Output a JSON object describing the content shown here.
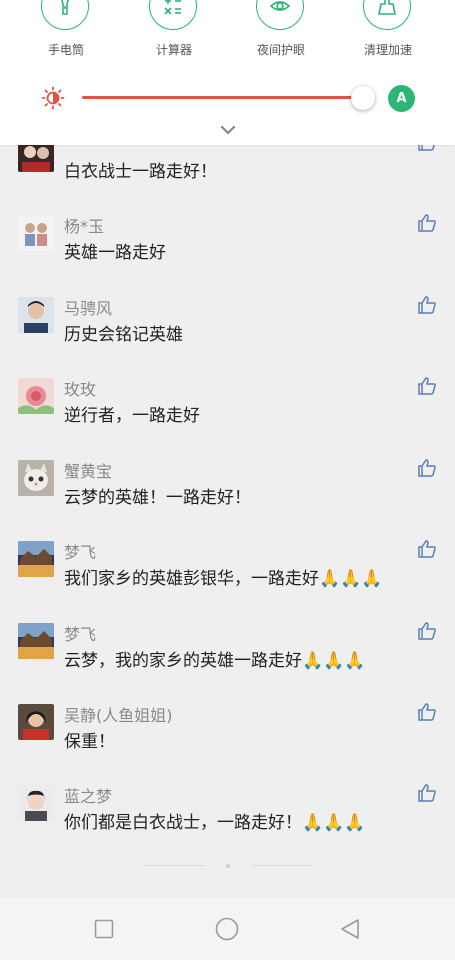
{
  "quick_tiles": [
    {
      "label": "手电筒",
      "icon": "flashlight-icon"
    },
    {
      "label": "计算器",
      "icon": "calculator-icon"
    },
    {
      "label": "夜间护眼",
      "icon": "eye-care-icon"
    },
    {
      "label": "清理加速",
      "icon": "broom-icon"
    }
  ],
  "brightness": {
    "level": 0.95,
    "auto_label": "A",
    "icon": "brightness-sun-icon",
    "accent": "#e3533f"
  },
  "colors": {
    "green": "#2bb673",
    "like": "#5a7fb8"
  },
  "comments": [
    {
      "name": "...",
      "text": "白衣战士一路走好！"
    },
    {
      "name": "杨*玉",
      "text": "英雄一路走好"
    },
    {
      "name": "马骋风",
      "text": "历史会铭记英雄"
    },
    {
      "name": "玫玫",
      "text": "逆行者，一路走好"
    },
    {
      "name": "蟹黄宝",
      "text": "云梦的英雄！一路走好！"
    },
    {
      "name": "梦飞",
      "text": "我们家乡的英雄彭银华，一路走好🙏🙏🙏"
    },
    {
      "name": "梦飞",
      "text": "云梦，我的家乡的英雄一路走好🙏🙏🙏"
    },
    {
      "name": "吴静(人鱼姐姐)",
      "text": "保重！"
    },
    {
      "name": "蓝之梦",
      "text": "你们都是白衣战士，一路走好！🙏🙏🙏"
    }
  ],
  "nav": [
    "square-icon",
    "circle-home-icon",
    "triangle-back-icon"
  ]
}
